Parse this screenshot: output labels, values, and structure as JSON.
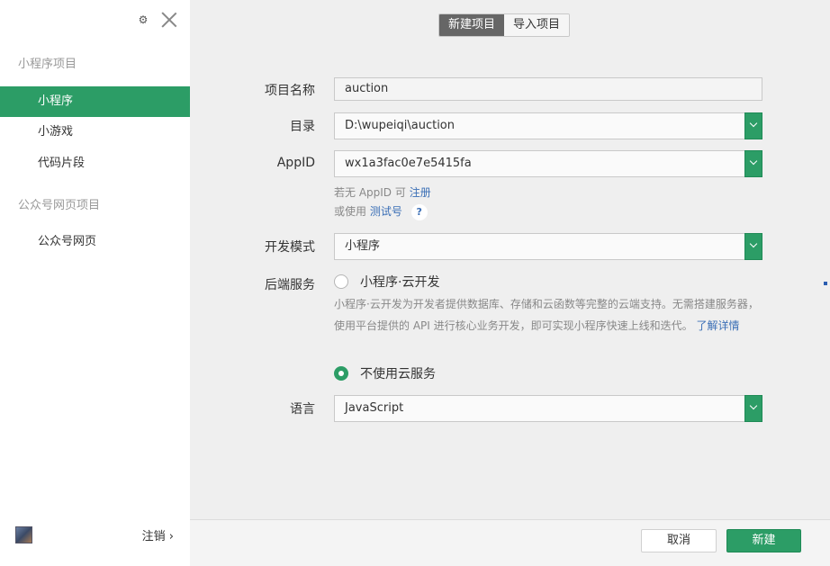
{
  "sidebar": {
    "miniprogram_section": "小程序项目",
    "items": [
      {
        "label": "小程序",
        "active": true
      },
      {
        "label": "小游戏",
        "active": false
      },
      {
        "label": "代码片段",
        "active": false
      }
    ],
    "official_section": "公众号网页项目",
    "official_items": [
      {
        "label": "公众号网页"
      }
    ],
    "logout_label": "注销 ›"
  },
  "tabs": [
    {
      "label": "新建项目",
      "active": true
    },
    {
      "label": "导入项目",
      "active": false
    }
  ],
  "form": {
    "project_name_label": "项目名称",
    "project_name_value": "auction",
    "directory_label": "目录",
    "directory_value": "D:\\wupeiqi\\auction",
    "appid_label": "AppID",
    "appid_value": "wx1a3fac0e7e5415fa",
    "appid_hint_prefix": "若无 AppID 可",
    "appid_hint_link": "注册",
    "test_hint_prefix": "或使用",
    "test_hint_link": "测试号",
    "help_icon": "?",
    "dev_mode_label": "开发模式",
    "dev_mode_value": "小程序",
    "backend_label": "后端服务",
    "cloud_option_label": "小程序·云开发",
    "cloud_option_selected": false,
    "cloud_desc": "小程序·云开发为开发者提供数据库、存储和云函数等完整的云端支持。无需搭建服务器，使用平台提供的 API 进行核心业务开发，即可实现小程序快速上线和迭代。",
    "cloud_desc_link": "了解详情",
    "no_cloud_label": "不使用云服务",
    "no_cloud_selected": true,
    "language_label": "语言",
    "language_value": "JavaScript"
  },
  "footer": {
    "cancel_label": "取消",
    "create_label": "新建"
  },
  "colors": {
    "accent": "#2c9d66",
    "link": "#3b6fb6"
  }
}
